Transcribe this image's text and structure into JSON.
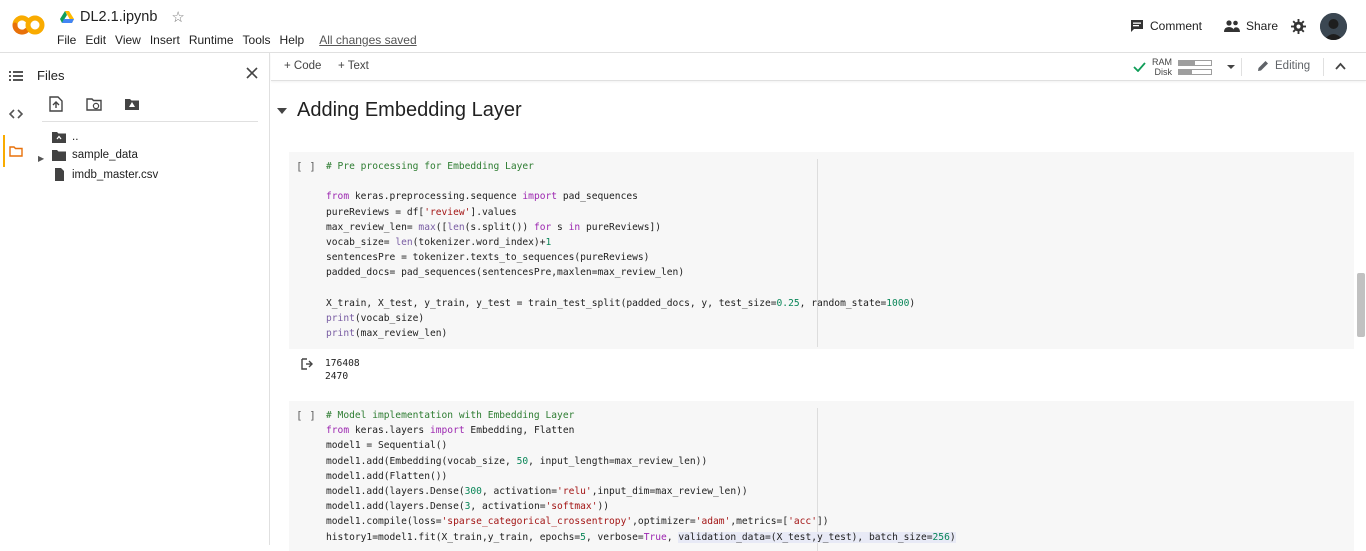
{
  "header": {
    "title": "DL2.1.ipynb",
    "menu": [
      "File",
      "Edit",
      "View",
      "Insert",
      "Runtime",
      "Tools",
      "Help"
    ],
    "save_status": "All changes saved",
    "comment_label": "Comment",
    "share_label": "Share"
  },
  "files_panel": {
    "title": "Files",
    "items": [
      {
        "label": "..",
        "icon": "folder-up-icon"
      },
      {
        "label": "sample_data",
        "icon": "folder-icon"
      },
      {
        "label": "imdb_master.csv",
        "icon": "file-icon"
      }
    ]
  },
  "toolbar": {
    "add_code": "+ Code",
    "add_text": "+ Text",
    "ram_label": "RAM",
    "disk_label": "Disk",
    "ram_usage": 0.5,
    "disk_usage": 0.4,
    "editing_label": "Editing"
  },
  "notebook": {
    "section_title": "Adding Embedding Layer",
    "cell1": {
      "bracket": "[ ]",
      "output": "176408\n2470"
    },
    "cell2": {
      "bracket": "[ ]"
    }
  },
  "colors": {
    "accent": "#f9ab00",
    "keyword": "#9c27b0",
    "comment": "#2e7d32",
    "string": "#a31515"
  }
}
